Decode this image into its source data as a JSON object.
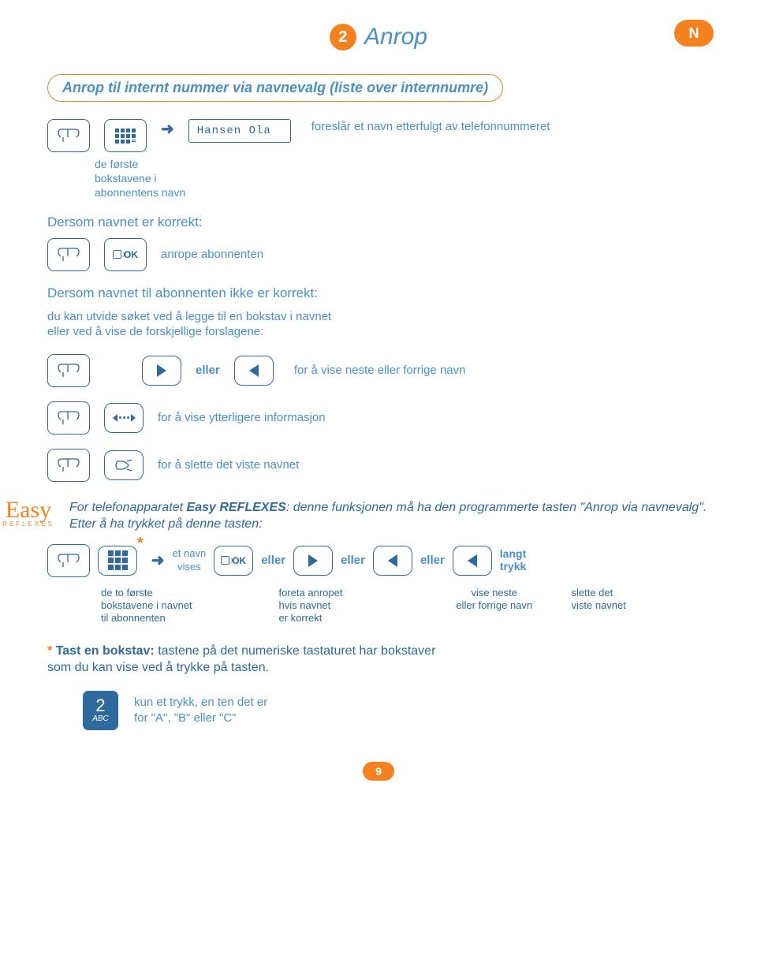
{
  "header": {
    "step_num": "2",
    "title": "Anrop",
    "side_letter": "N"
  },
  "section_title": "Anrop til internt nummer via navnevalg (liste over internnumre)",
  "step1": {
    "display_text": "Hansen Ola",
    "caption_left": "de første\nbokstavene i\nabonnentens navn",
    "caption_right": "foreslår et navn etterfulgt av telefonnummeret"
  },
  "if_correct_heading": "Dersom navnet er korrekt:",
  "if_correct": {
    "ok_label": "OK",
    "caption": "anrope abonnenten"
  },
  "if_not_heading": "Dersom navnet til abonnenten ikke er korrekt:",
  "if_not_body": "du kan utvide søket ved å legge til en bokstav i navnet\neller ved å vise de forskjellige forslagene:",
  "nav_row": {
    "eller": "eller",
    "caption": "for å vise neste eller forrige navn"
  },
  "info_row_caption": "for å vise ytterligere informasjon",
  "delete_row_caption": "for å slette det viste navnet",
  "easy": {
    "logo_word": "Easy",
    "logo_sub": "REFLEXES",
    "text_pre": "For telefonapparatet ",
    "text_bold": "Easy REFLEXES",
    "text_mid": ": denne funksjonen må ha den programmerte tasten ",
    "text_q1": "\"Anrop via navnevalg\"",
    "text_post": ". Etter å ha trykket på denne tasten:"
  },
  "complex": {
    "name_shown": "et navn\nvises",
    "ok_label": "OK",
    "eller": "eller",
    "long_press": "langt\ntrykk"
  },
  "caption_row": {
    "c1": "de to første\nbokstavene i navnet\ntil abonnenten",
    "c2": "foreta anropet\nhvis navnet\ner korrekt",
    "c3": "vise neste\neller forrige navn",
    "c4": "slette det\nviste navnet"
  },
  "footnote": {
    "star": "*",
    "bold": "Tast en bokstav:",
    "rest": " tastene på det numeriske tastaturet har bokstaver\nsom du kan vise ved å trykke på tasten."
  },
  "key2": {
    "num": "2",
    "abc": "ABC",
    "caption": "kun et trykk, en ten det er\nfor \"A\", \"B\" eller \"C\""
  },
  "page_num": "9"
}
